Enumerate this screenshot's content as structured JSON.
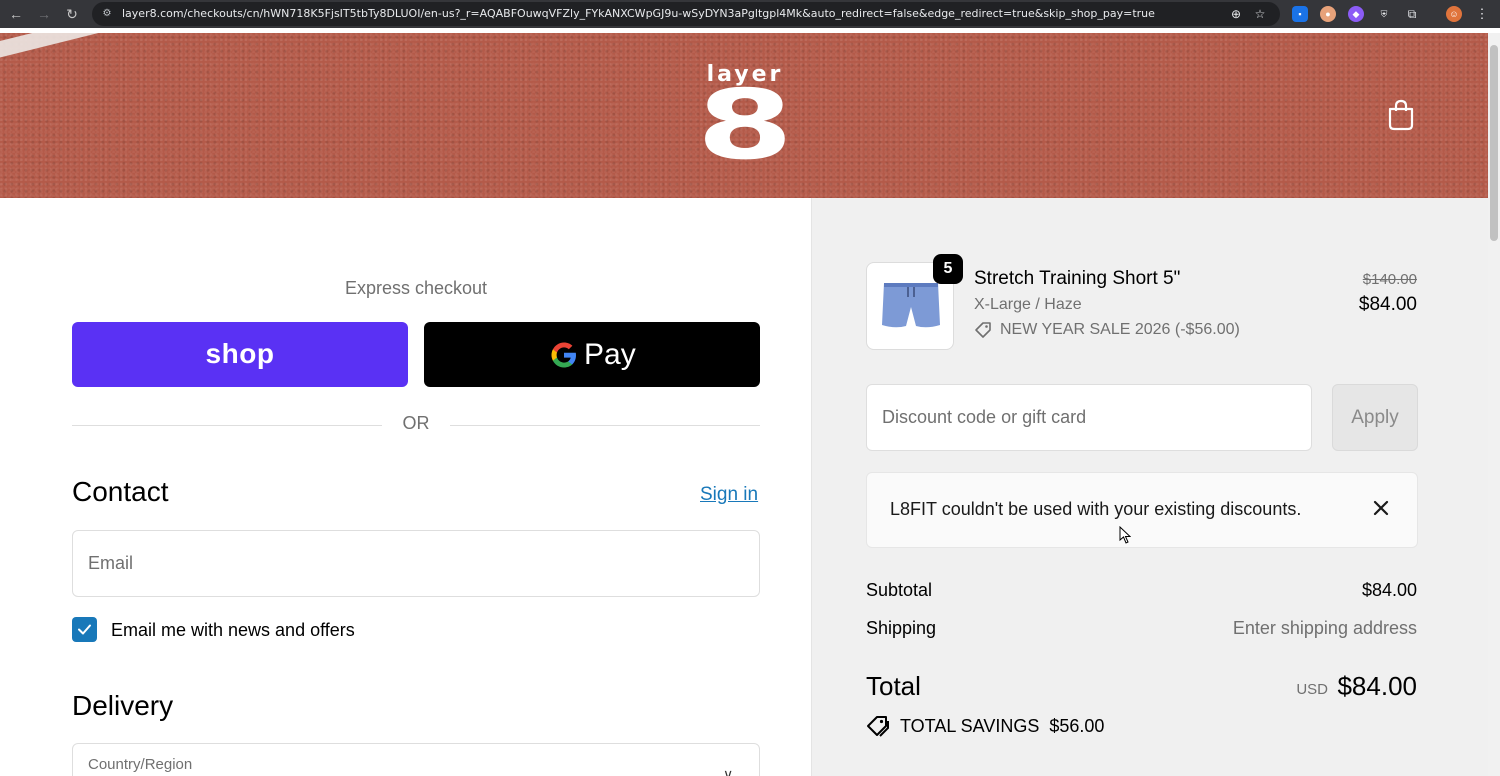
{
  "browser": {
    "url": "layer8.com/checkouts/cn/hWN718K5FjsIT5tbTy8DLUOI/en-us?_r=AQABFOuwqVFZly_FYkANXCWpGJ9u-wSyDYN3aPgltgpl4Mk&auto_redirect=false&edge_redirect=true&skip_shop_pay=true",
    "icons": [
      "back-icon",
      "forward-icon",
      "reload-icon",
      "site-info-icon",
      "zoom-icon",
      "bookmark-star-icon",
      "extensions-icon",
      "menu-icon"
    ]
  },
  "header": {
    "logo_word": "layer",
    "logo_mark": "8",
    "cart_icon": "shopping-bag-icon"
  },
  "express": {
    "title": "Express checkout",
    "shop_label": "shop",
    "gpay_label": "Pay",
    "or_label": "OR"
  },
  "contact": {
    "heading": "Contact",
    "sign_in": "Sign in",
    "email_placeholder": "Email",
    "newsletter_label": "Email me with news and offers",
    "newsletter_checked": true
  },
  "delivery": {
    "heading": "Delivery",
    "country_label": "Country/Region"
  },
  "cart": {
    "item": {
      "quantity": "5",
      "name": "Stretch Training Short 5\"",
      "variant": "X-Large / Haze",
      "discount": "NEW YEAR SALE 2026 (-$56.00)",
      "original_price": "$140.00",
      "price": "$84.00"
    },
    "discount_placeholder": "Discount code or gift card",
    "apply_label": "Apply",
    "notice": "L8FIT couldn't be used with your existing discounts.",
    "subtotal_label": "Subtotal",
    "subtotal_value": "$84.00",
    "shipping_label": "Shipping",
    "shipping_value": "Enter shipping address",
    "total_label": "Total",
    "total_currency": "USD",
    "total_value": "$84.00",
    "savings_label": "TOTAL SAVINGS",
    "savings_value": "$56.00"
  },
  "colors": {
    "shop_pay": "#5a31f4",
    "link": "#1878b9",
    "banner": "#b45a49"
  }
}
